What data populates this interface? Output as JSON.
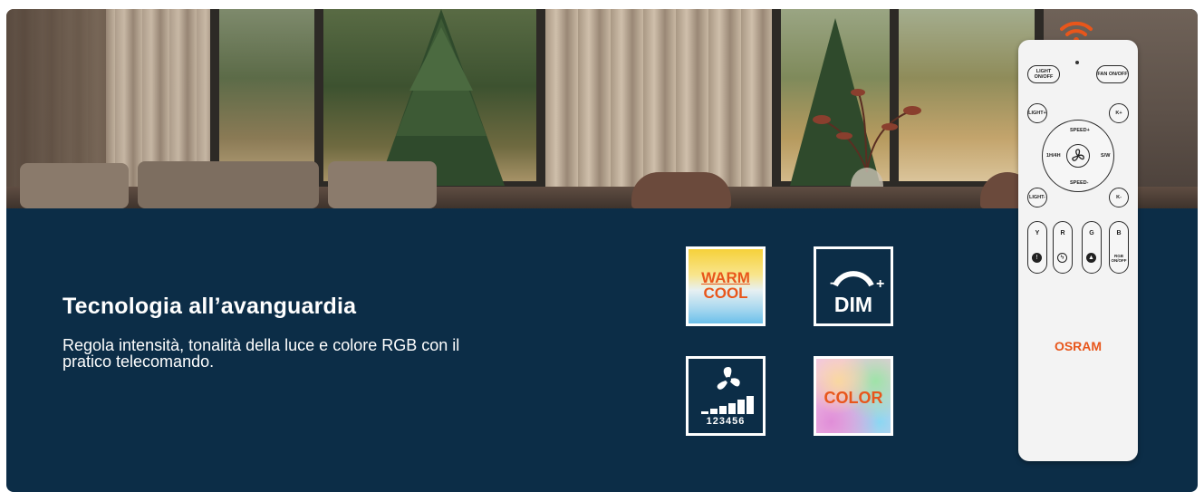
{
  "banner": {
    "title": "Tecnologia all’avanguardia",
    "description": "Regola intensità, tonalità della luce e colore RGB con il pratico telecomando."
  },
  "features": {
    "warm_cool": {
      "line1": "WARM",
      "line2": "COOL",
      "icon": "warm-cool-icon"
    },
    "dim": {
      "label": "DIM",
      "minus": "−",
      "plus": "+",
      "icon": "dim-icon"
    },
    "fan": {
      "levels": "123456",
      "icon": "fan-speed-icon"
    },
    "color": {
      "label": "COLOR",
      "icon": "rgb-color-icon"
    }
  },
  "remote": {
    "brand": "OSRAM",
    "buttons": {
      "light_onoff": "LIGHT ON/OFF",
      "fan_onoff": "FAN ON/OFF",
      "light_plus": "LIGHT+",
      "light_minus": "LIGHT-",
      "k_plus": "K+",
      "k_minus": "K-",
      "speed_plus": "SPEED+",
      "speed_minus": "SPEED-",
      "timer": "1H/4H",
      "season": "S/W",
      "y": "Y",
      "r": "R",
      "g": "G",
      "b": "B",
      "rgb_onoff": "RGB ON/OFF"
    }
  },
  "colors": {
    "background": "#0c2d47",
    "accent": "#e8561b",
    "text": "#ffffff"
  }
}
